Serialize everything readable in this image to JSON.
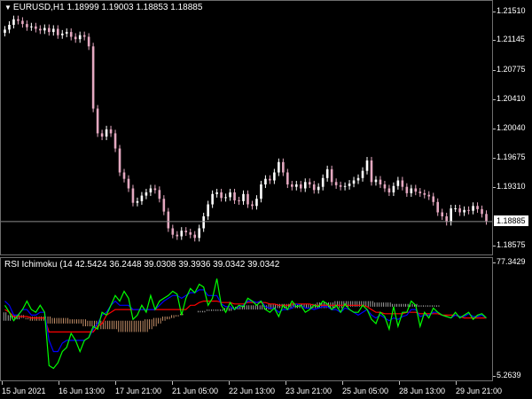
{
  "symbol_header": "EURUSD,H1  1.18999 1.19003 1.18853 1.18885",
  "indicator_header": "RSI Ichimoku (14 42.5424 36.2448 39.0308 39.3936 39.0342 39.0342",
  "current_price": "1.18885",
  "colors": {
    "background": "#000000",
    "bull_candle": "#ffffff",
    "bear_candle": "#e4a8c0",
    "rsi_line": "#00ff00",
    "tenkan_line": "#0000ff",
    "kijun_line": "#ff0000",
    "cloud_bull": "#c8c8c8",
    "cloud_bear": "#f0b080"
  },
  "icons": {
    "pane_marker": "triangle-down-icon"
  },
  "price_axis": [
    {
      "id": "p1",
      "label": "1.21510",
      "value": 1.2151
    },
    {
      "id": "p2",
      "label": "1.21145",
      "value": 1.21145
    },
    {
      "id": "p3",
      "label": "1.20775",
      "value": 1.20775
    },
    {
      "id": "p4",
      "label": "1.20410",
      "value": 1.2041
    },
    {
      "id": "p5",
      "label": "1.20040",
      "value": 1.2004
    },
    {
      "id": "p6",
      "label": "1.19675",
      "value": 1.19675
    },
    {
      "id": "p7",
      "label": "1.19310",
      "value": 1.1931
    },
    {
      "id": "p9",
      "label": "1.18575",
      "value": 1.18575
    }
  ],
  "indicator_axis": {
    "max_label": "77.3429",
    "min_label": "5.2639"
  },
  "time_axis": [
    {
      "id": "t1",
      "label": "15 Jun 2021"
    },
    {
      "id": "t2",
      "label": "16 Jun 13:00"
    },
    {
      "id": "t3",
      "label": "17 Jun 21:00"
    },
    {
      "id": "t4",
      "label": "21 Jun 05:00"
    },
    {
      "id": "t5",
      "label": "22 Jun 13:00"
    },
    {
      "id": "t6",
      "label": "23 Jun 21:00"
    },
    {
      "id": "t7",
      "label": "25 Jun 05:00"
    },
    {
      "id": "t8",
      "label": "28 Jun 13:00"
    },
    {
      "id": "t9",
      "label": "29 Jun 21:00"
    }
  ],
  "chart_data": [
    {
      "type": "line",
      "title": "EURUSD,H1",
      "ylim": [
        1.1845,
        1.2165
      ],
      "series": [
        {
          "name": "EURUSD,H1",
          "values": [
            1.2129,
            1.2135,
            1.2142,
            1.214,
            1.2136,
            1.2132,
            1.2133,
            1.213,
            1.2128,
            1.2131,
            1.2126,
            1.213,
            1.2122,
            1.2124,
            1.2126,
            1.212,
            1.2117,
            1.2122,
            1.212,
            1.2108,
            1.203,
            1.1999,
            1.1995,
            1.2004,
            1.1999,
            1.198,
            1.195,
            1.1942,
            1.193,
            1.1912,
            1.1914,
            1.1921,
            1.1925,
            1.193,
            1.1928,
            1.1917,
            1.1901,
            1.188,
            1.1872,
            1.187,
            1.1877,
            1.1875,
            1.1872,
            1.1868,
            1.188,
            1.1895,
            1.191,
            1.1923,
            1.1925,
            1.1918,
            1.1919,
            1.1925,
            1.1915,
            1.1914,
            1.1923,
            1.191,
            1.1908,
            1.1917,
            1.1935,
            1.1942,
            1.194,
            1.195,
            1.1963,
            1.195,
            1.1935,
            1.1932,
            1.1935,
            1.193,
            1.1938,
            1.1935,
            1.1928,
            1.1932,
            1.1943,
            1.1954,
            1.1938,
            1.1934,
            1.1932,
            1.1933,
            1.1936,
            1.194,
            1.1943,
            1.1952,
            1.1965,
            1.1938,
            1.1941,
            1.1935,
            1.193,
            1.1925,
            1.1933,
            1.194,
            1.1932,
            1.1924,
            1.193,
            1.1926,
            1.1924,
            1.1922,
            1.192,
            1.1913,
            1.19,
            1.1895,
            1.1888,
            1.1905,
            1.1905,
            1.19,
            1.1903,
            1.1902,
            1.1908,
            1.1904,
            1.1898,
            1.1889
          ]
        }
      ]
    },
    {
      "type": "line",
      "title": "RSI Ichimoku",
      "ylim": [
        5.2639,
        77.3429
      ],
      "series": [
        {
          "name": "RSI",
          "values": [
            55,
            50,
            44,
            48,
            52,
            58,
            52,
            50,
            55,
            50,
            12,
            10,
            14,
            22,
            25,
            35,
            30,
            22,
            30,
            32,
            40,
            38,
            50,
            48,
            55,
            62,
            58,
            65,
            60,
            45,
            48,
            55,
            50,
            62,
            52,
            58,
            60,
            62,
            65,
            63,
            48,
            60,
            67,
            64,
            70,
            68,
            55,
            60,
            74,
            55,
            50,
            57,
            52,
            55,
            54,
            60,
            58,
            55,
            58,
            52,
            50,
            53,
            47,
            55,
            52,
            58,
            54,
            55,
            50,
            52,
            55,
            54,
            58,
            56,
            52,
            55,
            50,
            56,
            52,
            50,
            50,
            55,
            52,
            45,
            42,
            50,
            47,
            38,
            54,
            40,
            50,
            50,
            58,
            55,
            40,
            50,
            46,
            53,
            50,
            48,
            47,
            46,
            50,
            46,
            48,
            50,
            45,
            48,
            49,
            46
          ]
        },
        {
          "name": "Tenkan",
          "values": [
            58,
            55,
            48,
            48,
            52,
            52,
            48,
            48,
            50,
            50,
            30,
            22,
            22,
            28,
            30,
            30,
            30,
            30,
            30,
            32,
            38,
            42,
            48,
            50,
            55,
            58,
            55,
            55,
            55,
            52,
            52,
            52,
            52,
            52,
            52,
            55,
            58,
            60,
            62,
            62,
            60,
            62,
            64,
            64,
            66,
            66,
            62,
            62,
            62,
            56,
            54,
            54,
            52,
            54,
            55,
            58,
            58,
            57,
            58,
            54,
            53,
            53,
            50,
            52,
            52,
            53,
            56,
            55,
            53,
            53,
            52,
            53,
            54,
            54,
            52,
            52,
            50,
            53,
            52,
            50,
            48,
            50,
            52,
            48,
            46,
            48,
            46,
            44,
            46,
            45,
            47,
            48,
            52,
            52,
            47,
            48,
            48,
            50,
            50,
            48,
            47,
            46,
            48,
            47,
            47,
            49,
            47,
            47,
            48,
            46
          ]
        },
        {
          "name": "Kijun",
          "values": [
            52,
            50,
            47,
            47,
            47,
            47,
            46,
            46,
            46,
            46,
            36,
            36,
            36,
            36,
            36,
            36,
            36,
            36,
            36,
            36,
            36,
            40,
            42,
            48,
            50,
            52,
            52,
            52,
            52,
            52,
            52,
            52,
            52,
            52,
            52,
            52,
            52,
            52,
            52,
            52,
            52,
            52,
            55,
            55,
            57,
            58,
            58,
            58,
            58,
            57,
            57,
            57,
            56,
            56,
            56,
            57,
            57,
            57,
            57,
            57,
            56,
            56,
            55,
            55,
            55,
            56,
            56,
            56,
            56,
            56,
            55,
            55,
            55,
            55,
            55,
            55,
            55,
            55,
            55,
            55,
            55,
            55,
            54,
            52,
            50,
            50,
            49,
            49,
            49,
            49,
            49,
            50,
            50,
            50,
            49,
            49,
            49,
            49,
            49,
            48,
            48,
            48,
            48,
            47,
            46,
            46,
            46,
            46,
            46,
            46
          ]
        },
        {
          "name": "Senkou A",
          "values": [
            50,
            48,
            48,
            48,
            48,
            45,
            44,
            44,
            44,
            44,
            42,
            42,
            42,
            42,
            42,
            42,
            42,
            42,
            40,
            40,
            40,
            40,
            38,
            38,
            38,
            38,
            36,
            36,
            36,
            36,
            36,
            36,
            36,
            38,
            40,
            42,
            44,
            45,
            46,
            47,
            48,
            49,
            50,
            50,
            51,
            51,
            52,
            52,
            52,
            52,
            53,
            53,
            54,
            54,
            55,
            55,
            55,
            55,
            55,
            55,
            56,
            56,
            56,
            56,
            56,
            56,
            56,
            56,
            56,
            56,
            56,
            57,
            57,
            57,
            57,
            58,
            58,
            58,
            58,
            58,
            58,
            58,
            58,
            58,
            57,
            57,
            57,
            57,
            56,
            56,
            56,
            56,
            56,
            56,
            55,
            55,
            55,
            55,
            55,
            54,
            54,
            54,
            54,
            54,
            54,
            54,
            54,
            54,
            54,
            54
          ]
        },
        {
          "name": "Senkou B",
          "values": [
            44,
            44,
            45,
            45,
            46,
            46,
            47,
            47,
            47,
            47,
            47,
            46,
            46,
            46,
            46,
            45,
            45,
            45,
            45,
            44,
            44,
            44,
            44,
            44,
            44,
            44,
            44,
            44,
            44,
            44,
            44,
            44,
            45,
            45,
            46,
            46,
            47,
            47,
            48,
            48,
            49,
            49,
            50,
            50,
            50,
            50,
            51,
            51,
            51,
            51,
            51,
            51,
            52,
            52,
            52,
            52,
            52,
            52,
            52,
            52,
            52,
            52,
            53,
            53,
            53,
            53,
            53,
            53,
            53,
            53,
            53,
            53,
            53,
            53,
            53,
            53,
            53,
            54,
            54,
            54,
            54,
            54,
            54,
            54,
            54,
            54,
            54,
            54,
            54,
            54,
            54,
            54,
            54,
            54,
            54,
            54,
            54,
            54,
            54,
            54,
            54,
            54,
            54,
            54,
            54,
            54,
            54,
            54,
            54,
            54
          ]
        }
      ]
    }
  ]
}
